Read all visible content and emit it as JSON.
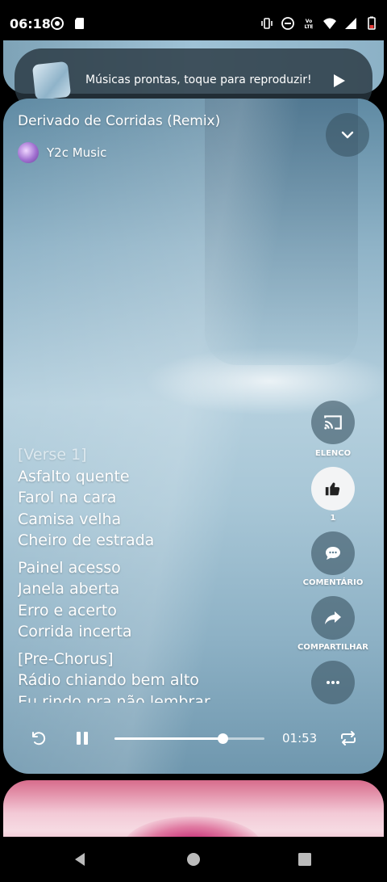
{
  "status_bar": {
    "time": "06:18",
    "left_icons": [
      "record-icon",
      "sd-card-icon"
    ],
    "right_icons": [
      "vibrate-icon",
      "do-not-disturb-icon",
      "volte-icon",
      "wifi-icon",
      "signal-icon",
      "battery-low-icon"
    ],
    "volte_text": "Vo LTE"
  },
  "ready_banner": {
    "text": "Músicas prontas, toque para reproduzir!",
    "play_icon": "play-icon"
  },
  "track": {
    "title": "Derivado de Corridas (Remix)",
    "artist": "Y2c Music"
  },
  "lyrics": {
    "lines": [
      "[Verse 1]",
      "Asfalto quente",
      "Farol na cara",
      "Camisa velha",
      "Cheiro de estrada",
      "",
      "Painel acesso",
      "Janela aberta",
      "Erro e acerto",
      "Corrida incerta",
      "",
      "[Pre-Chorus]",
      "Rádio chiando bem alto",
      "Eu rindo pra não lembrar"
    ]
  },
  "actions": {
    "cast_label": "ELENCO",
    "like_count": "1",
    "comment_label": "COMENTÁRIO",
    "share_label": "COMPARTILHAR"
  },
  "player": {
    "time": "01:53",
    "progress_fraction": 0.72,
    "state": "playing"
  },
  "colors": {
    "accent": "#ffffff",
    "battery_low": "#e53935",
    "like_button_bg": "#f3f4f5"
  }
}
